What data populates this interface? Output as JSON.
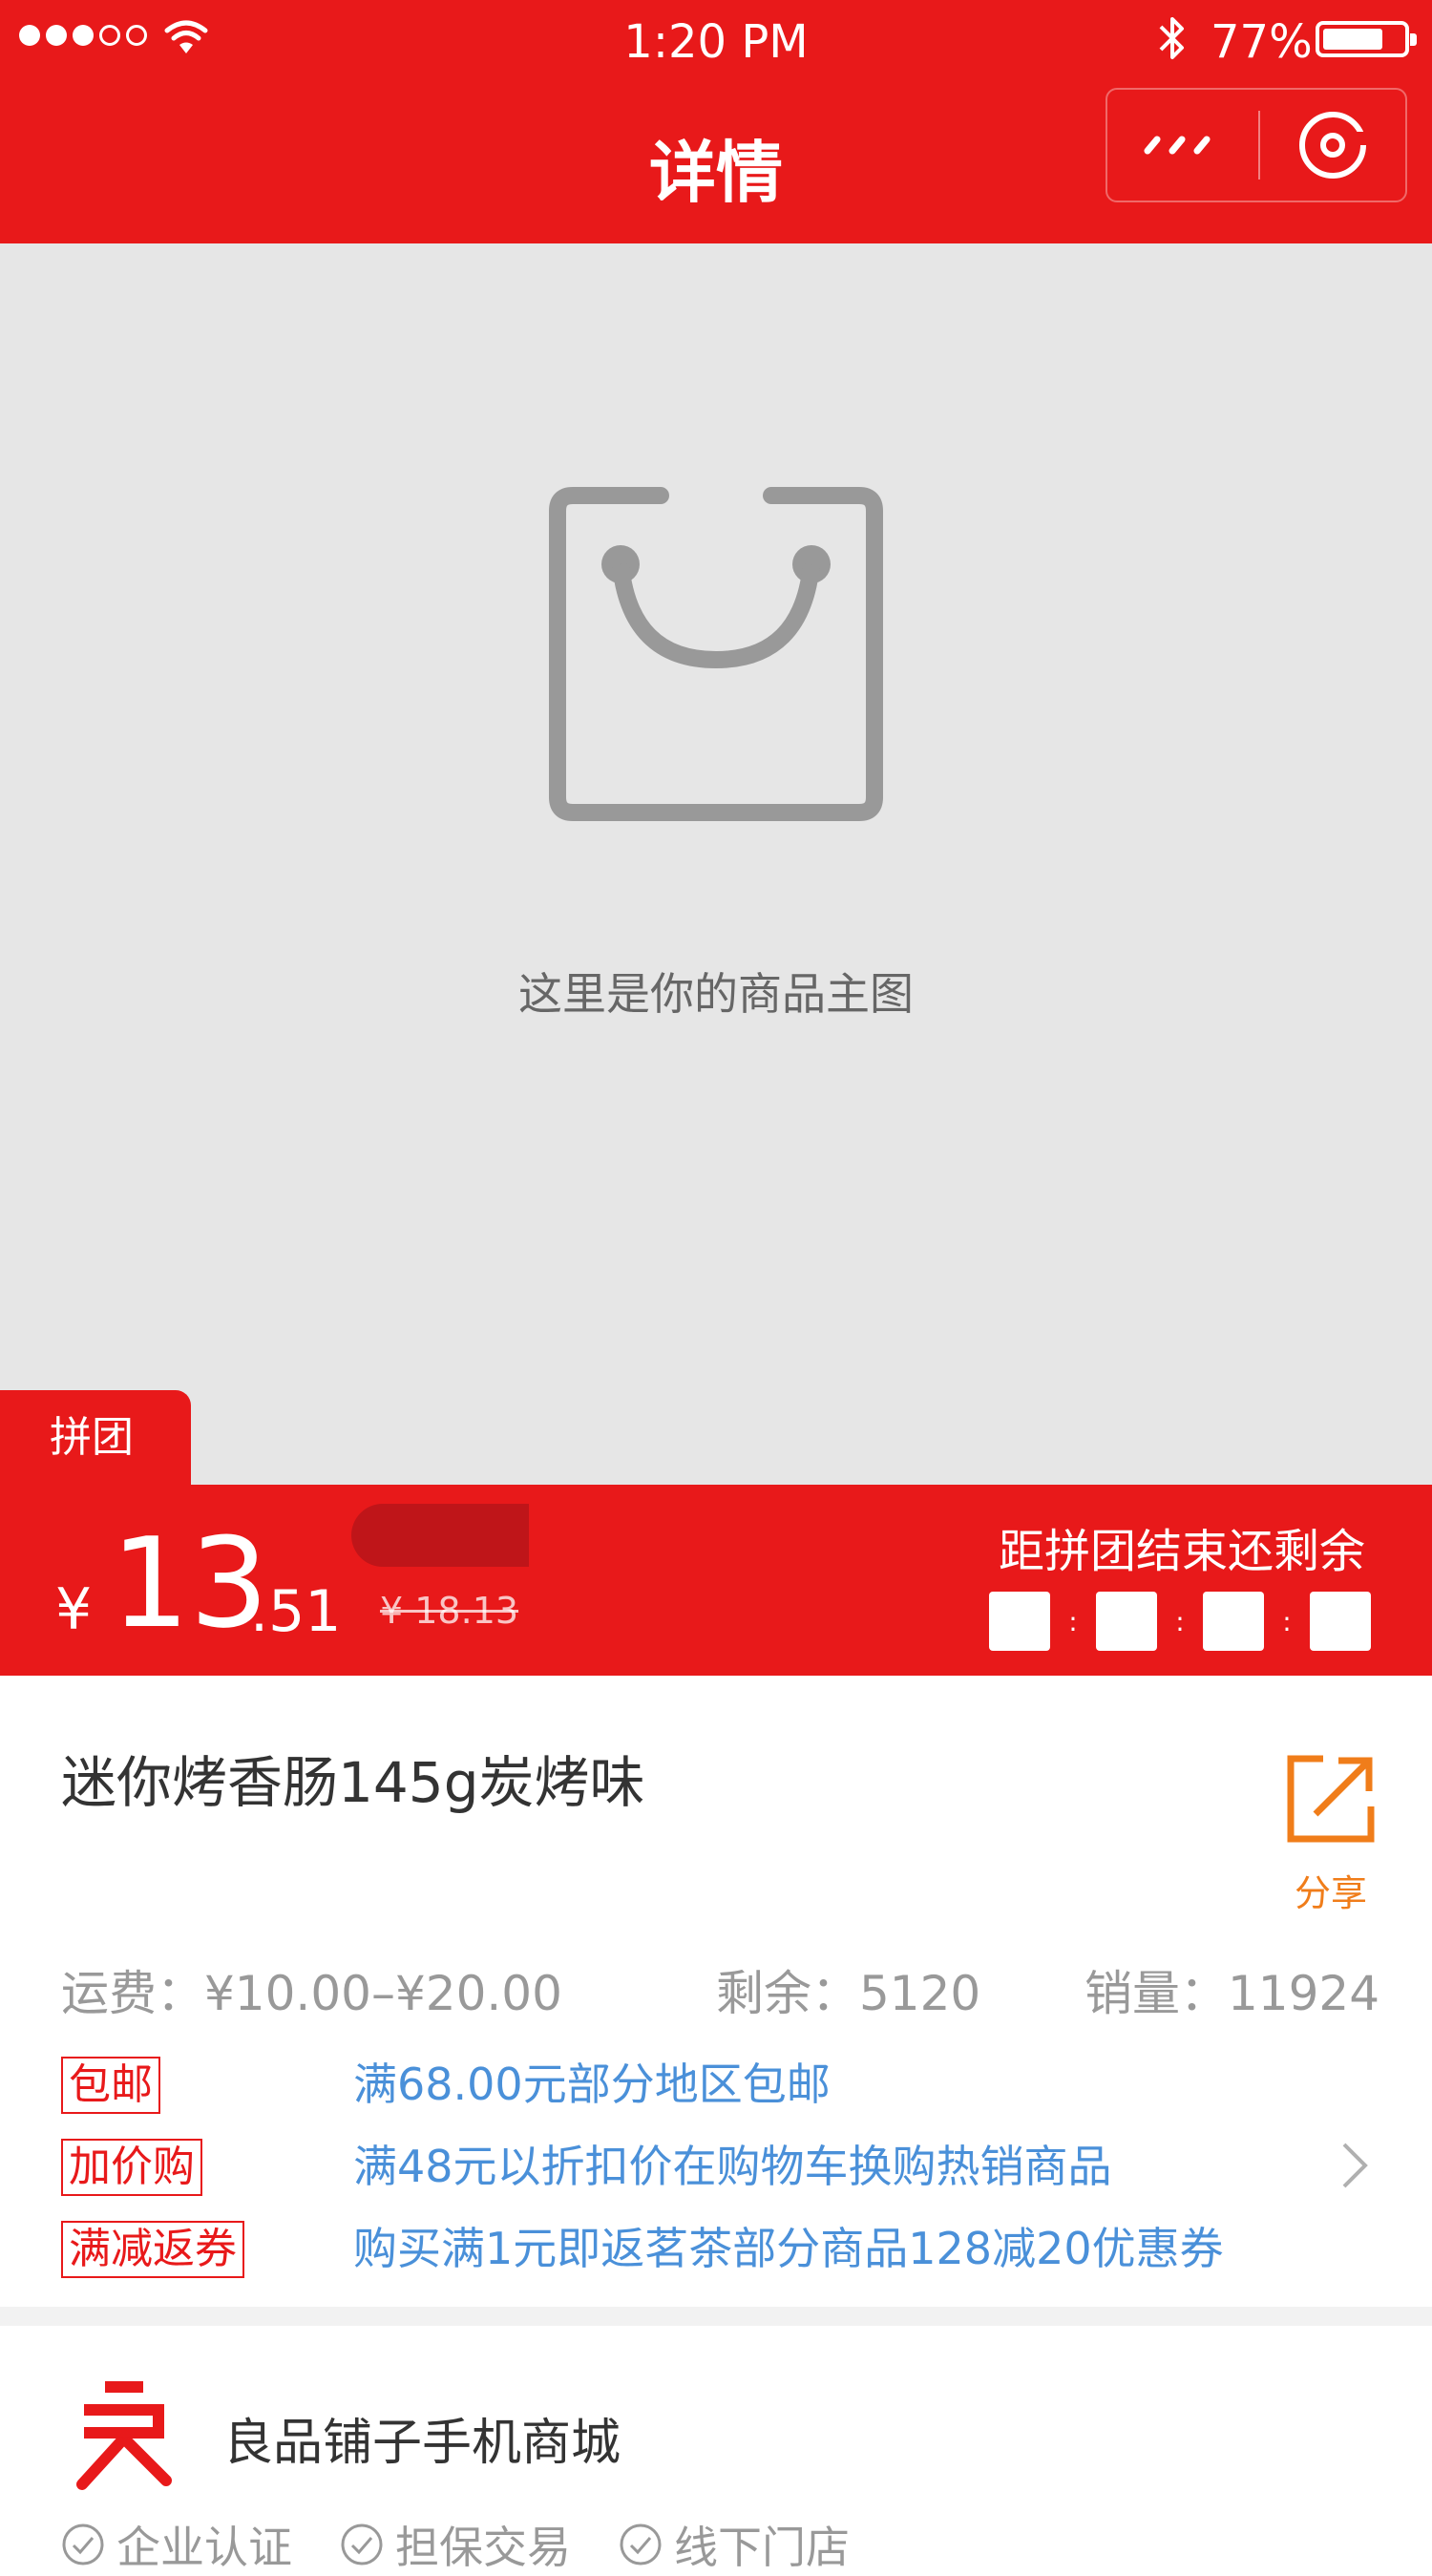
{
  "status_bar": {
    "time": "1:20 PM",
    "battery": "77%",
    "signal_bars_filled": 3,
    "signal_bars_total": 5,
    "battery_level": 0.77
  },
  "nav": {
    "title": "详情"
  },
  "hero": {
    "caption": "这里是你的商品主图"
  },
  "price": {
    "tag": "拼团",
    "currency": "¥",
    "integer": "13",
    "decimal": ".51",
    "original": "¥ 18.13",
    "countdown_label": "距拼团结束还剩余",
    "countdown_separator": ":"
  },
  "product": {
    "title": "迷你烤香肠145g炭烤味",
    "share_label": "分享",
    "shipping": "运费：¥10.00–¥20.00",
    "stock": "剩余：5120",
    "sales": "销量：11924"
  },
  "promotions": [
    {
      "tag": "包邮",
      "text": "满68.00元部分地区包邮"
    },
    {
      "tag": "加价购",
      "text": "满48元以折扣价在购物车换购热销商品"
    },
    {
      "tag": "满减返券",
      "text": "购买满1元即返茗茶部分商品128减20优惠券"
    }
  ],
  "shop": {
    "name": "良品铺子手机商城",
    "badges": [
      "企业认证",
      "担保交易",
      "线下门店"
    ]
  },
  "colors": {
    "brand_red": "#e8191a",
    "promo_blue": "#4a90d9",
    "share_orange": "#f07d1a",
    "placeholder_gray": "#e6e6e6"
  }
}
